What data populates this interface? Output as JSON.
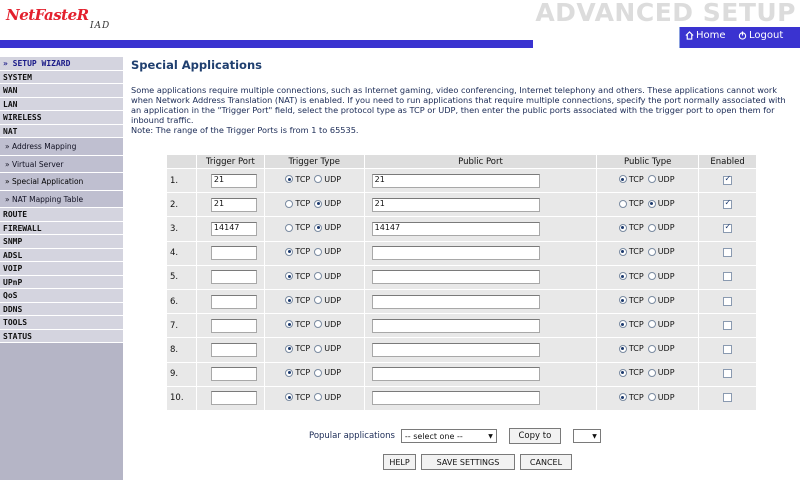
{
  "header": {
    "logo_main": "NetFasteR",
    "logo_sub": "IAD",
    "title": "ADVANCED SETUP",
    "home_label": "Home",
    "logout_label": "Logout",
    "bar_color": "#3a33d0"
  },
  "sidebar": {
    "items": [
      {
        "label": "» SETUP WIZARD",
        "type": "top"
      },
      {
        "label": "SYSTEM",
        "type": "item"
      },
      {
        "label": "WAN",
        "type": "item"
      },
      {
        "label": "LAN",
        "type": "item"
      },
      {
        "label": "WIRELESS",
        "type": "item"
      },
      {
        "label": "NAT",
        "type": "item"
      },
      {
        "label": "» Address Mapping",
        "type": "sub"
      },
      {
        "label": "» Virtual Server",
        "type": "sub"
      },
      {
        "label": "» Special Application",
        "type": "sub"
      },
      {
        "label": "» NAT Mapping Table",
        "type": "sub"
      },
      {
        "label": "ROUTE",
        "type": "item"
      },
      {
        "label": "FIREWALL",
        "type": "item"
      },
      {
        "label": "SNMP",
        "type": "item"
      },
      {
        "label": "ADSL",
        "type": "item"
      },
      {
        "label": "VOIP",
        "type": "item"
      },
      {
        "label": "UPnP",
        "type": "item"
      },
      {
        "label": "QoS",
        "type": "item"
      },
      {
        "label": "DDNS",
        "type": "item"
      },
      {
        "label": "TOOLS",
        "type": "item"
      },
      {
        "label": "STATUS",
        "type": "item"
      }
    ]
  },
  "main": {
    "title": "Special Applications",
    "description": "Some applications require multiple connections, such as Internet gaming, video conferencing, Internet telephony and others. These applications cannot work when Network Address Translation (NAT) is enabled. If you need to run applications that require multiple connections, specify the port normally associated with an application in the \"Trigger Port\" field, select the protocol type as TCP or UDP, then enter the public ports associated with the trigger port to open them for inbound traffic.",
    "note": "Note: The range of the Trigger Ports is from 1 to 65535."
  },
  "table": {
    "headers": [
      "",
      "Trigger Port",
      "Trigger Type",
      "Public Port",
      "Public Type",
      "Enabled"
    ],
    "tcp_label": "TCP",
    "udp_label": "UDP",
    "rows": [
      {
        "num": "1.",
        "trigger_port": "21",
        "trigger_type": "TCP",
        "public_port": "21",
        "public_type": "TCP",
        "enabled": true
      },
      {
        "num": "2.",
        "trigger_port": "21",
        "trigger_type": "UDP",
        "public_port": "21",
        "public_type": "UDP",
        "enabled": true
      },
      {
        "num": "3.",
        "trigger_port": "14147",
        "trigger_type": "UDP",
        "public_port": "14147",
        "public_type": "TCP",
        "enabled": true
      },
      {
        "num": "4.",
        "trigger_port": "",
        "trigger_type": "TCP",
        "public_port": "",
        "public_type": "TCP",
        "enabled": false
      },
      {
        "num": "5.",
        "trigger_port": "",
        "trigger_type": "TCP",
        "public_port": "",
        "public_type": "TCP",
        "enabled": false
      },
      {
        "num": "6.",
        "trigger_port": "",
        "trigger_type": "TCP",
        "public_port": "",
        "public_type": "TCP",
        "enabled": false
      },
      {
        "num": "7.",
        "trigger_port": "",
        "trigger_type": "TCP",
        "public_port": "",
        "public_type": "TCP",
        "enabled": false
      },
      {
        "num": "8.",
        "trigger_port": "",
        "trigger_type": "TCP",
        "public_port": "",
        "public_type": "TCP",
        "enabled": false
      },
      {
        "num": "9.",
        "trigger_port": "",
        "trigger_type": "TCP",
        "public_port": "",
        "public_type": "TCP",
        "enabled": false
      },
      {
        "num": "10.",
        "trigger_port": "",
        "trigger_type": "TCP",
        "public_port": "",
        "public_type": "TCP",
        "enabled": false
      }
    ]
  },
  "popular": {
    "label": "Popular applications",
    "select_value": "-- select one --",
    "copy_label": "Copy to",
    "copy_target_value": ""
  },
  "buttons": {
    "help": "HELP",
    "save": "SAVE SETTINGS",
    "cancel": "CANCEL"
  }
}
